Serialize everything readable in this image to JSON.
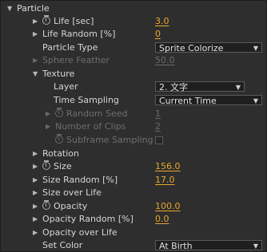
{
  "panel": {
    "header": "Particle",
    "rows": {
      "life": {
        "label": "Life [sec]",
        "value": "3.0"
      },
      "life_random": {
        "label": "Life Random [%]",
        "value": "0"
      },
      "particle_type": {
        "label": "Particle Type",
        "value": "Sprite Colorize"
      },
      "sphere_feather": {
        "label": "Sphere Feather",
        "value": "50.0"
      },
      "texture": {
        "label": "Texture"
      },
      "layer": {
        "label": "Layer",
        "value": "2. 文字"
      },
      "time_sampling": {
        "label": "Time Sampling",
        "value": "Current Time"
      },
      "random_seed": {
        "label": "Random Seed",
        "value": "1"
      },
      "number_of_clips": {
        "label": "Number of Clips",
        "value": "2"
      },
      "subframe_sampling": {
        "label": "Subframe Sampling"
      },
      "rotation": {
        "label": "Rotation"
      },
      "size": {
        "label": "Size",
        "value": "156.0"
      },
      "size_random": {
        "label": "Size Random [%]",
        "value": "17.0"
      },
      "size_over_life": {
        "label": "Size over Life"
      },
      "opacity": {
        "label": "Opacity",
        "value": "100.0"
      },
      "opacity_random": {
        "label": "Opacity Random [%]",
        "value": "0.0"
      },
      "opacity_over_life": {
        "label": "Opacity over Life"
      },
      "set_color": {
        "label": "Set Color",
        "value": "At Birth"
      }
    }
  },
  "colors": {
    "accent_value": "#e8a72a",
    "background": "#2e2e2e",
    "disabled": "#6e6e6e"
  },
  "icons": {
    "expand": "triangle-right",
    "collapse": "triangle-down",
    "stopwatch": "stopwatch-icon",
    "dropdown": "triangle-down"
  }
}
